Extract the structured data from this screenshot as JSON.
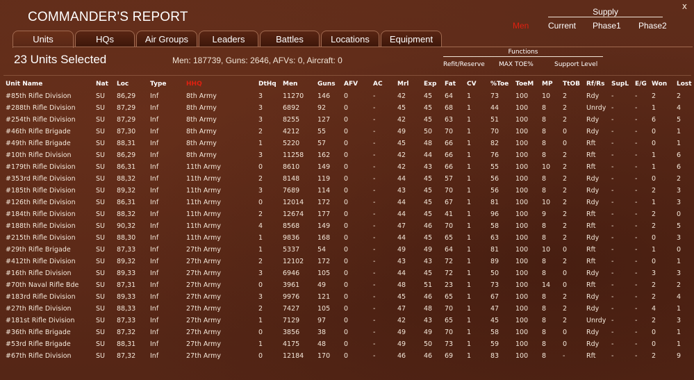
{
  "window": {
    "title": "COMMANDER'S REPORT",
    "close_label": "x"
  },
  "supply": {
    "header": "Supply",
    "men_label": "Men",
    "columns": [
      "Current",
      "Phase1",
      "Phase2"
    ]
  },
  "tabs": [
    {
      "label": "Units",
      "active": true
    },
    {
      "label": "HQs",
      "active": false
    },
    {
      "label": "Air Groups",
      "active": false
    },
    {
      "label": "Leaders",
      "active": false
    },
    {
      "label": "Battles",
      "active": false
    },
    {
      "label": "Locations",
      "active": false
    },
    {
      "label": "Equipment",
      "active": false
    }
  ],
  "summary": {
    "units_selected": "23 Units Selected",
    "totals": "Men: 187739, Guns: 2646, AFVs: 0, Aircraft: 0"
  },
  "functions": {
    "header": "Functions",
    "items": [
      "Refit/Reserve",
      "MAX TOE%",
      "Support Level"
    ]
  },
  "colors": {
    "background": "#5c2a18",
    "highlight_red": "#e02010",
    "text": "#f4e8da"
  },
  "table": {
    "headers": [
      "Unit Name",
      "Nat",
      "Loc",
      "Type",
      "HHQ",
      "DtHq",
      "Men",
      "Guns",
      "AFV",
      "AC",
      "Mrl",
      "Exp",
      "Fat",
      "CV",
      "%Toe",
      "ToeM",
      "MP",
      "TtOB",
      "Rf/Rs",
      "SupL",
      "E/G",
      "Won",
      "Lost"
    ],
    "rows": [
      [
        "#85th Rifle Division",
        "SU",
        "86,29",
        "Inf",
        "8th Army",
        "3",
        "11270",
        "146",
        "0",
        "-",
        "42",
        "45",
        "64",
        "1",
        "73",
        "100",
        "10",
        "2",
        "Rdy",
        "-",
        "-",
        "2",
        "2"
      ],
      [
        "#288th Rifle Division",
        "SU",
        "87,29",
        "Inf",
        "8th Army",
        "3",
        "6892",
        "92",
        "0",
        "-",
        "45",
        "45",
        "68",
        "1",
        "44",
        "100",
        "8",
        "2",
        "Unrdy",
        "-",
        "-",
        "1",
        "4"
      ],
      [
        "#254th Rifle Division",
        "SU",
        "87,29",
        "Inf",
        "8th Army",
        "3",
        "8255",
        "127",
        "0",
        "-",
        "42",
        "45",
        "63",
        "1",
        "51",
        "100",
        "8",
        "2",
        "Rdy",
        "-",
        "-",
        "6",
        "5"
      ],
      [
        "#46th Rifle Brigade",
        "SU",
        "87,30",
        "Inf",
        "8th Army",
        "2",
        "4212",
        "55",
        "0",
        "-",
        "49",
        "50",
        "70",
        "1",
        "70",
        "100",
        "8",
        "0",
        "Rdy",
        "-",
        "-",
        "0",
        "1"
      ],
      [
        "#49th Rifle Brigade",
        "SU",
        "88,31",
        "Inf",
        "8th Army",
        "1",
        "5220",
        "57",
        "0",
        "-",
        "45",
        "48",
        "66",
        "1",
        "82",
        "100",
        "8",
        "0",
        "Rft",
        "-",
        "-",
        "0",
        "1"
      ],
      [
        "#10th Rifle Division",
        "SU",
        "86,29",
        "Inf",
        "8th Army",
        "3",
        "11258",
        "162",
        "0",
        "-",
        "42",
        "44",
        "66",
        "1",
        "76",
        "100",
        "8",
        "2",
        "Rft",
        "-",
        "-",
        "1",
        "6"
      ],
      [
        "#179th Rifle Division",
        "SU",
        "86,31",
        "Inf",
        "11th Army",
        "0",
        "8610",
        "149",
        "0",
        "-",
        "42",
        "43",
        "66",
        "1",
        "55",
        "100",
        "10",
        "2",
        "Rft",
        "-",
        "-",
        "1",
        "6"
      ],
      [
        "#353rd Rifle Division",
        "SU",
        "88,32",
        "Inf",
        "11th Army",
        "2",
        "8148",
        "119",
        "0",
        "-",
        "44",
        "45",
        "57",
        "1",
        "56",
        "100",
        "8",
        "2",
        "Rdy",
        "-",
        "-",
        "0",
        "2"
      ],
      [
        "#185th Rifle Division",
        "SU",
        "89,32",
        "Inf",
        "11th Army",
        "3",
        "7689",
        "114",
        "0",
        "-",
        "43",
        "45",
        "70",
        "1",
        "56",
        "100",
        "8",
        "2",
        "Rdy",
        "-",
        "-",
        "2",
        "3"
      ],
      [
        "#126th Rifle Division",
        "SU",
        "86,31",
        "Inf",
        "11th Army",
        "0",
        "12014",
        "172",
        "0",
        "-",
        "44",
        "45",
        "67",
        "1",
        "81",
        "100",
        "10",
        "2",
        "Rdy",
        "-",
        "-",
        "1",
        "3"
      ],
      [
        "#184th Rifle Division",
        "SU",
        "88,32",
        "Inf",
        "11th Army",
        "2",
        "12674",
        "177",
        "0",
        "-",
        "44",
        "45",
        "41",
        "1",
        "96",
        "100",
        "9",
        "2",
        "Rft",
        "-",
        "-",
        "2",
        "0"
      ],
      [
        "#188th Rifle Division",
        "SU",
        "90,32",
        "Inf",
        "11th Army",
        "4",
        "8568",
        "149",
        "0",
        "-",
        "47",
        "46",
        "70",
        "1",
        "58",
        "100",
        "8",
        "2",
        "Rft",
        "-",
        "-",
        "2",
        "5"
      ],
      [
        "#215th Rifle Division",
        "SU",
        "88,30",
        "Inf",
        "11th Army",
        "1",
        "9836",
        "168",
        "0",
        "-",
        "44",
        "45",
        "65",
        "1",
        "63",
        "100",
        "8",
        "2",
        "Rdy",
        "-",
        "-",
        "0",
        "3"
      ],
      [
        "#29th Rifle Brigade",
        "SU",
        "87,33",
        "Inf",
        "27th Army",
        "1",
        "5337",
        "54",
        "0",
        "-",
        "49",
        "49",
        "64",
        "1",
        "81",
        "100",
        "10",
        "0",
        "Rft",
        "-",
        "-",
        "1",
        "0"
      ],
      [
        "#412th Rifle Division",
        "SU",
        "89,32",
        "Inf",
        "27th Army",
        "2",
        "12102",
        "172",
        "0",
        "-",
        "43",
        "43",
        "72",
        "1",
        "89",
        "100",
        "8",
        "2",
        "Rft",
        "-",
        "-",
        "0",
        "1"
      ],
      [
        "#16th Rifle Division",
        "SU",
        "89,33",
        "Inf",
        "27th Army",
        "3",
        "6946",
        "105",
        "0",
        "-",
        "44",
        "45",
        "72",
        "1",
        "50",
        "100",
        "8",
        "0",
        "Rdy",
        "-",
        "-",
        "3",
        "3"
      ],
      [
        "#70th Naval Rifle Bde",
        "SU",
        "87,31",
        "Inf",
        "27th Army",
        "0",
        "3961",
        "49",
        "0",
        "-",
        "48",
        "51",
        "23",
        "1",
        "73",
        "100",
        "14",
        "0",
        "Rft",
        "-",
        "-",
        "2",
        "2"
      ],
      [
        "#183rd Rifle Division",
        "SU",
        "89,33",
        "Inf",
        "27th Army",
        "3",
        "9976",
        "121",
        "0",
        "-",
        "45",
        "46",
        "65",
        "1",
        "67",
        "100",
        "8",
        "2",
        "Rdy",
        "-",
        "-",
        "2",
        "4"
      ],
      [
        "#27th Rifle Division",
        "SU",
        "88,33",
        "Inf",
        "27th Army",
        "2",
        "7427",
        "105",
        "0",
        "-",
        "47",
        "48",
        "70",
        "1",
        "47",
        "100",
        "8",
        "2",
        "Rdy",
        "-",
        "-",
        "4",
        "1"
      ],
      [
        "#181st Rifle Division",
        "SU",
        "87,33",
        "Inf",
        "27th Army",
        "1",
        "7129",
        "97",
        "0",
        "-",
        "42",
        "43",
        "65",
        "1",
        "45",
        "100",
        "8",
        "2",
        "Unrdy",
        "-",
        "-",
        "2",
        "3"
      ],
      [
        "#36th Rifle Brigade",
        "SU",
        "87,32",
        "Inf",
        "27th Army",
        "0",
        "3856",
        "38",
        "0",
        "-",
        "49",
        "49",
        "70",
        "1",
        "58",
        "100",
        "8",
        "0",
        "Rdy",
        "-",
        "-",
        "0",
        "1"
      ],
      [
        "#53rd Rifle Brigade",
        "SU",
        "88,31",
        "Inf",
        "27th Army",
        "1",
        "4175",
        "48",
        "0",
        "-",
        "49",
        "50",
        "73",
        "1",
        "59",
        "100",
        "8",
        "0",
        "Rdy",
        "-",
        "-",
        "0",
        "1"
      ],
      [
        "#67th Rifle Division",
        "SU",
        "87,32",
        "Inf",
        "27th Army",
        "0",
        "12184",
        "170",
        "0",
        "-",
        "46",
        "46",
        "69",
        "1",
        "83",
        "100",
        "8",
        "-",
        "Rft",
        "-",
        "-",
        "2",
        "9"
      ]
    ]
  }
}
